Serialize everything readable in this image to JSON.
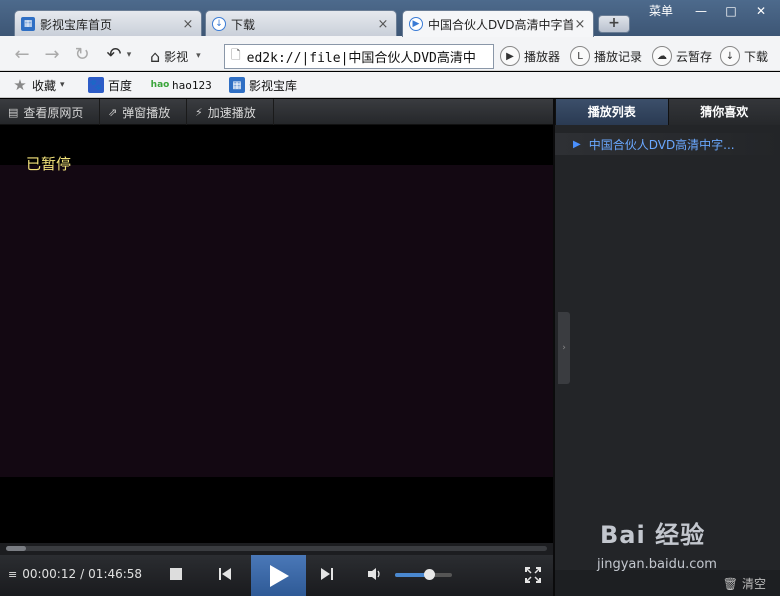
{
  "window": {
    "menu_label": "菜单",
    "minimize": "—",
    "maximize": "□",
    "close": "✕"
  },
  "tabs": [
    {
      "label": "影视宝库首页",
      "icon": "grid-app-icon",
      "close": "×"
    },
    {
      "label": "下载",
      "icon": "download-icon",
      "close": "×"
    },
    {
      "label": "中国合伙人DVD高清中字首",
      "icon": "play-circle-icon",
      "close": "×"
    }
  ],
  "new_tab": "+",
  "nav": {
    "home_label": "影视",
    "url": "ed2k://|file|中国合伙人DVD高清中"
  },
  "toolbar_buttons": [
    {
      "label": "播放器",
      "icon": "play-icon"
    },
    {
      "label": "播放记录",
      "icon": "clock-icon"
    },
    {
      "label": "云暂存",
      "icon": "cloud-icon"
    },
    {
      "label": "下载",
      "icon": "download-icon"
    }
  ],
  "bookmarks": [
    {
      "label": "收藏",
      "icon": "star-icon"
    },
    {
      "label": "百度",
      "icon": "baidu-paw-icon"
    },
    {
      "label": "hao123",
      "icon": "hao-icon"
    },
    {
      "label": "影视宝库",
      "icon": "grid-app-icon"
    }
  ],
  "player_bar": [
    {
      "label": "查看原网页",
      "icon": "page-icon"
    },
    {
      "label": "弹窗播放",
      "icon": "popout-icon"
    },
    {
      "label": "加速播放",
      "icon": "bolt-icon"
    }
  ],
  "video": {
    "status": "已暂停"
  },
  "playback": {
    "current": "00:00:12",
    "separator": "/",
    "total": "01:46:58",
    "progress": 0.003,
    "volume": 0.6
  },
  "sidebar": {
    "tabs": [
      {
        "label": "播放列表"
      },
      {
        "label": "猜你喜欢"
      }
    ],
    "playlist": [
      {
        "title": "中国合伙人DVD高清中字..."
      }
    ],
    "clear_label": "清空"
  },
  "watermark": {
    "logo": "Bai 经验",
    "url": "jingyan.baidu.com"
  }
}
